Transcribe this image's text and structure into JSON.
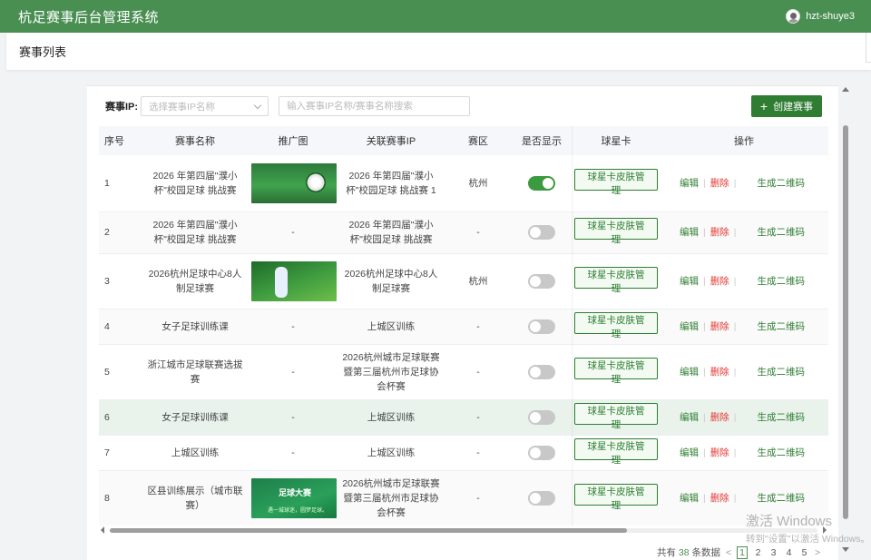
{
  "app": {
    "title": "杭足赛事后台管理系统",
    "username": "hzt-shuye3"
  },
  "tabbar": {
    "active_tab": "赛事列表"
  },
  "filters": {
    "ip_label": "赛事IP:",
    "ip_select_placeholder": "选择赛事IP名称",
    "search_placeholder": "输入赛事IP名称/赛事名称搜索",
    "create_label": "创建赛事"
  },
  "table": {
    "headers": {
      "idx": "序号",
      "name": "赛事名称",
      "promo": "推广图",
      "ip": "关联赛事IP",
      "region": "赛区",
      "show": "是否显示",
      "card": "球星卡",
      "ops": "操作"
    },
    "rows": [
      {
        "idx": "1",
        "name": "2026 年第四届\"濮小杯\"校园足球 挑战赛",
        "promo": "",
        "ip": "2026 年第四届\"濮小杯\"校园足球 挑战赛 1",
        "region": "杭州",
        "show": true
      },
      {
        "idx": "2",
        "name": "2026 年第四届\"濮小杯\"校园足球 挑战赛",
        "promo": "-",
        "ip": "2026 年第四届\"濮小杯\"校园足球 挑战赛",
        "region": "-",
        "show": false
      },
      {
        "idx": "3",
        "name": "2026杭州足球中心8人制足球赛",
        "promo": "",
        "ip": "2026杭州足球中心8人制足球赛",
        "region": "杭州",
        "show": false
      },
      {
        "idx": "4",
        "name": "女子足球训练课",
        "promo": "-",
        "ip": "上城区训练",
        "region": "-",
        "show": false
      },
      {
        "idx": "5",
        "name": "浙江城市足球联赛选拔赛",
        "promo": "-",
        "ip": "2026杭州城市足球联赛暨第三届杭州市足球协会杯赛",
        "region": "-",
        "show": false
      },
      {
        "idx": "6",
        "name": "女子足球训练课",
        "promo": "-",
        "ip": "上城区训练",
        "region": "-",
        "show": false
      },
      {
        "idx": "7",
        "name": "上城区训练",
        "promo": "-",
        "ip": "上城区训练",
        "region": "-",
        "show": false
      },
      {
        "idx": "8",
        "name": "区县训练展示（城市联赛）",
        "promo": "",
        "ip": "2026杭州城市足球联赛暨第三届杭州市足球协会杯赛",
        "region": "-",
        "show": false
      }
    ],
    "thumb3_title": "足球大赛",
    "thumb3_sub": "遇一城球迷，圆梦足球。",
    "skin_label": "球星卡皮肤管理",
    "edit_label": "编辑",
    "sep": "|",
    "delete_label": "删除",
    "qr_label": "生成二维码"
  },
  "pager": {
    "prefix": "共有",
    "total": "38",
    "suffix": "条数据",
    "prev": "<",
    "pages": [
      "1",
      "2",
      "3",
      "4",
      "5"
    ],
    "next": ">"
  },
  "watermark": {
    "line1": "激活 Windows",
    "line2": "转到\"设置\"以激活 Windows。"
  },
  "colors": {
    "primary": "#4a8f52",
    "button": "#2e7d32",
    "danger": "#e53935"
  }
}
